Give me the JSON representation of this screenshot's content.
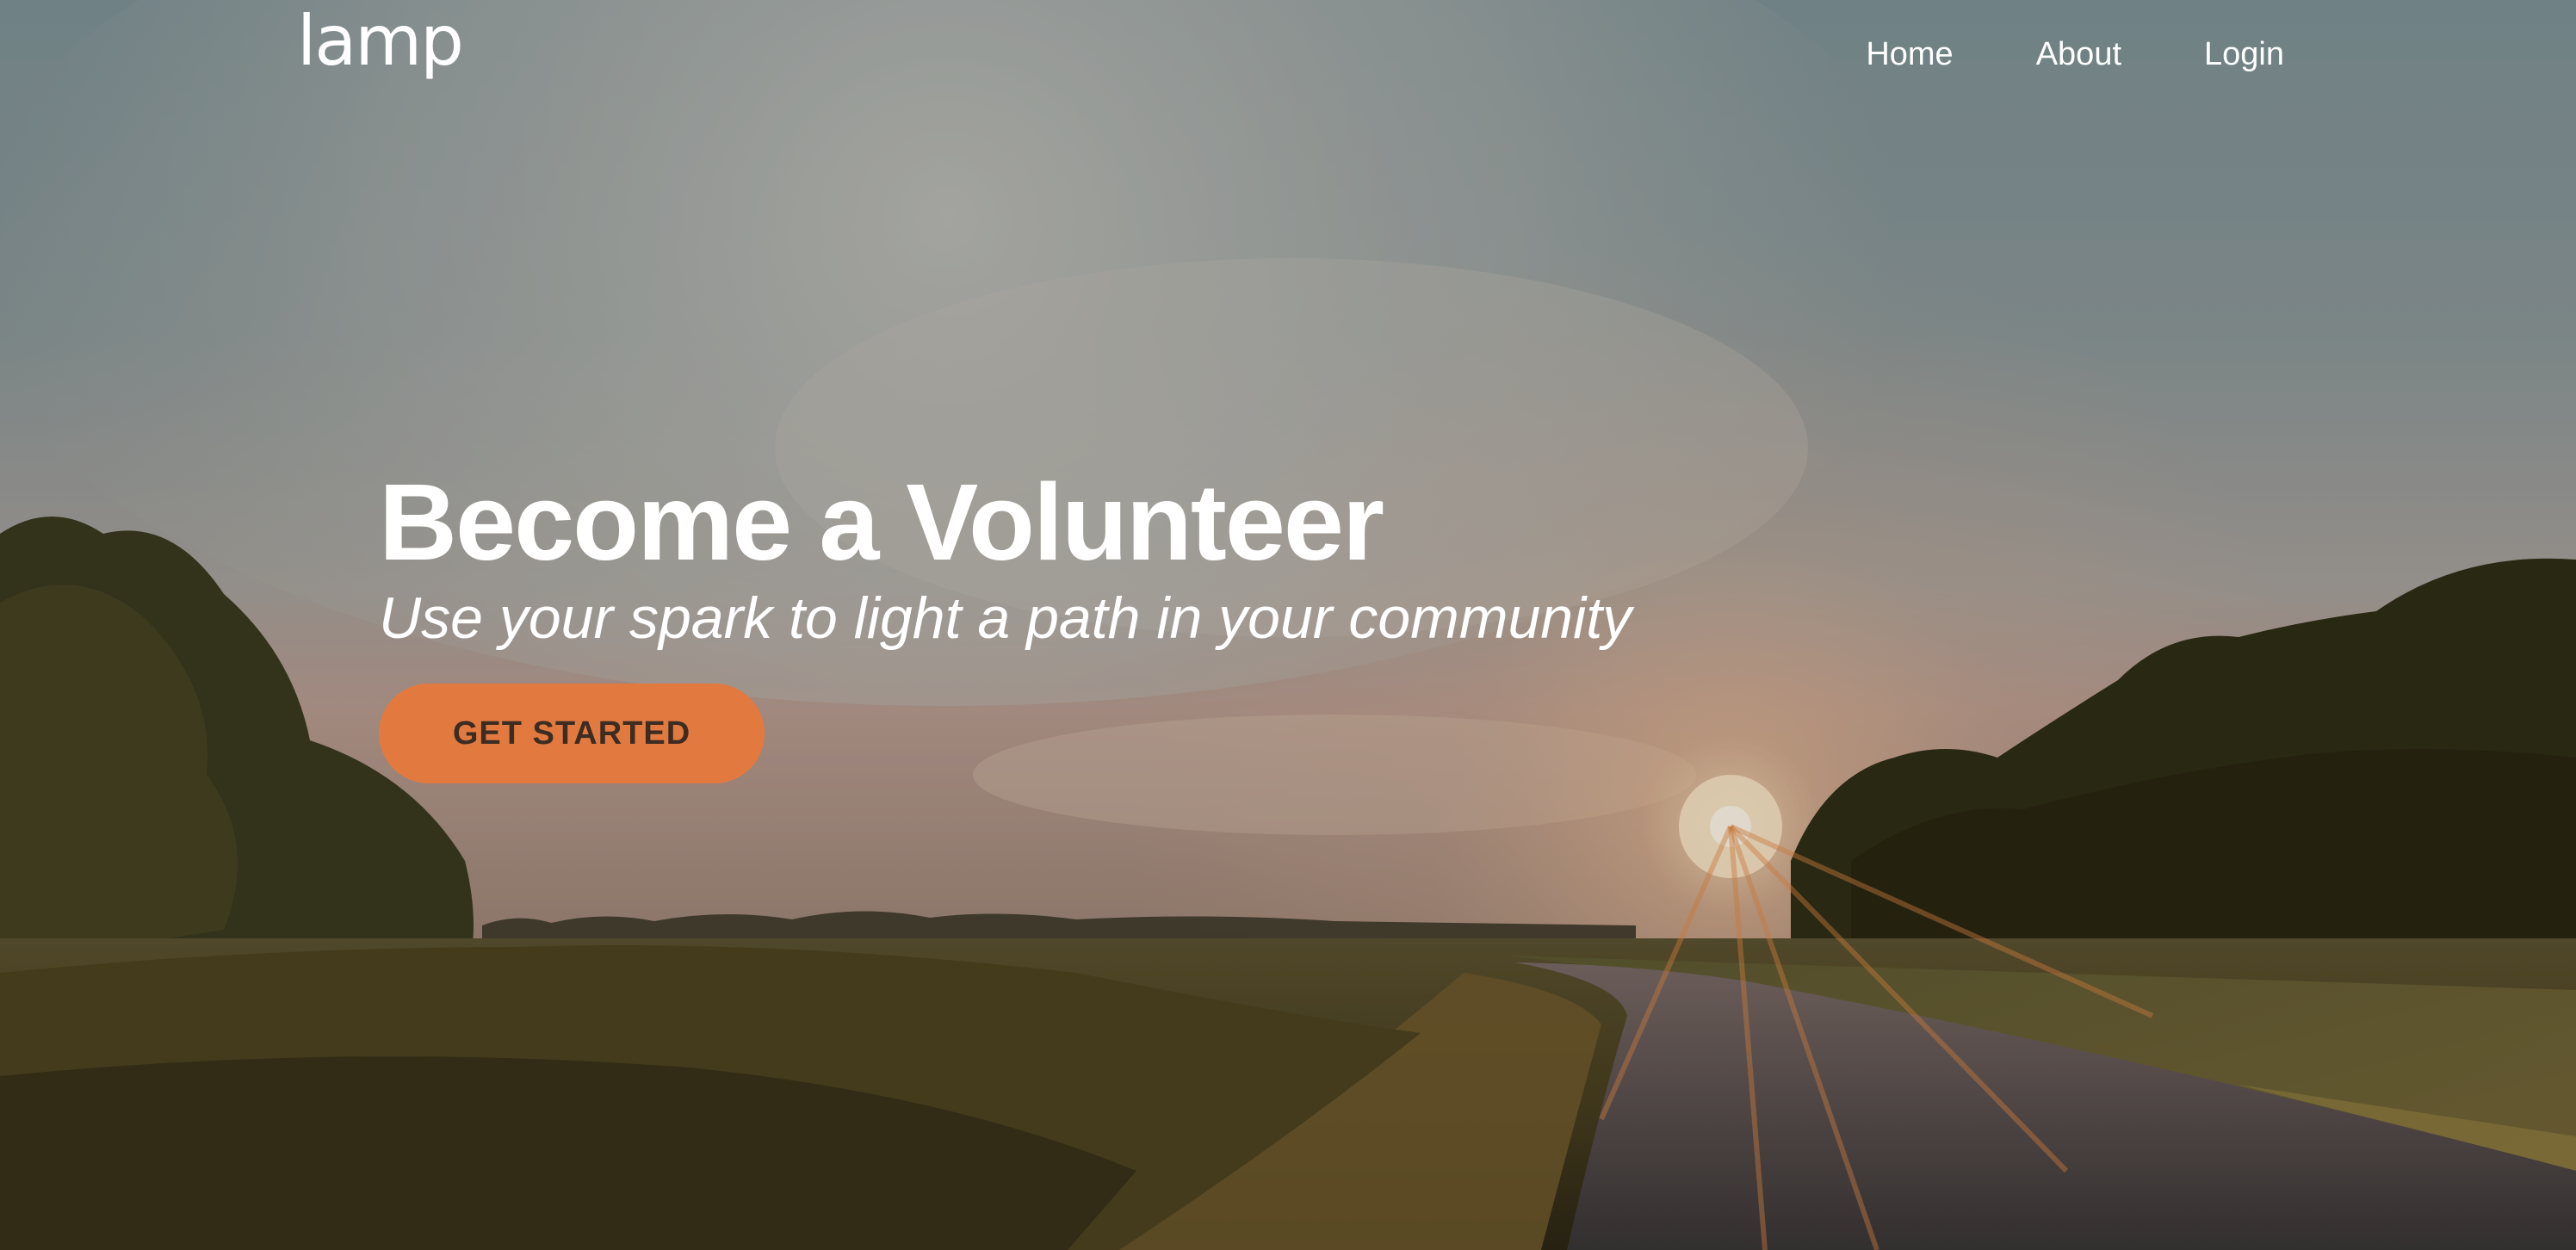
{
  "brand": {
    "logo_text": "lamp"
  },
  "nav": {
    "items": [
      "Home",
      "About",
      "Login"
    ]
  },
  "hero": {
    "title": "Become a Volunteer",
    "subtitle": "Use your spark to light a path in your community",
    "cta_label": "GET STARTED"
  },
  "colors": {
    "cta_background": "#e27a40",
    "cta_text": "#3c2c22",
    "nav_text": "#ffffff"
  }
}
